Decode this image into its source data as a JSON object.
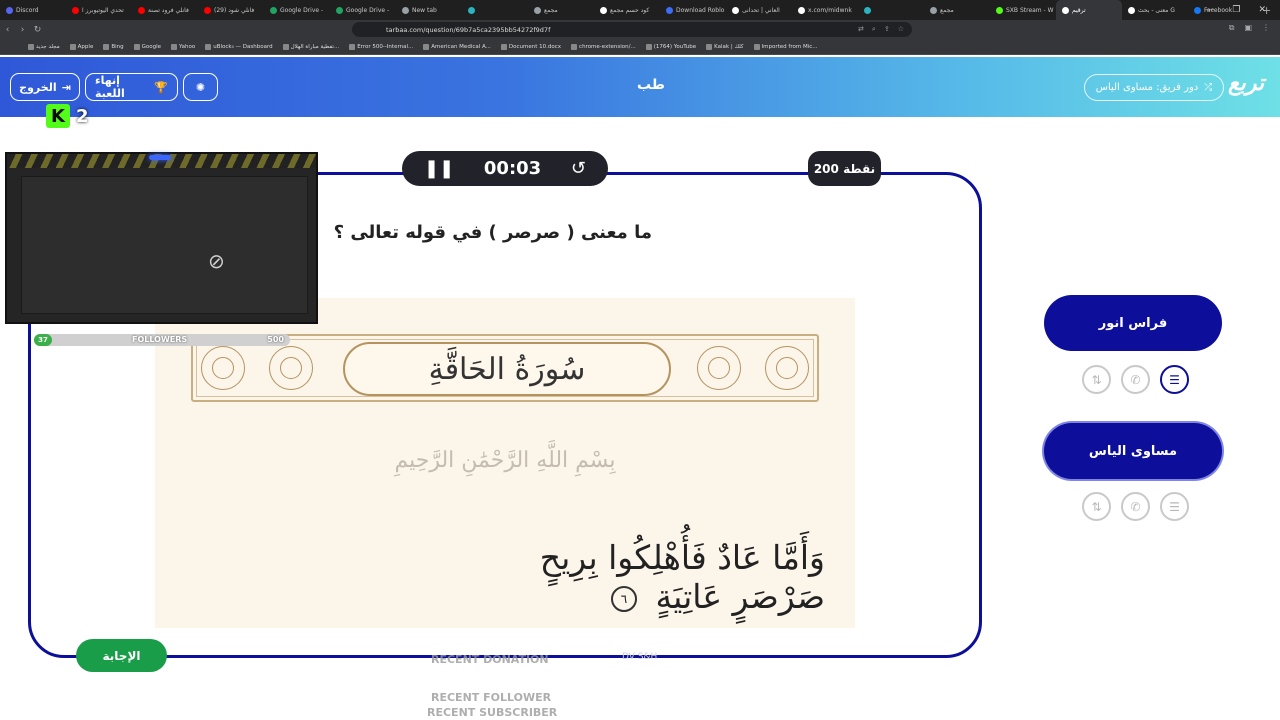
{
  "browser": {
    "tabs": [
      {
        "label": "Discord",
        "color": "#5865f2",
        "active": false
      },
      {
        "label": "تحدي اليوتيوبرز ا",
        "color": "#ff0000",
        "active": false
      },
      {
        "label": "فانلي فرود تصنة",
        "color": "#ff0000",
        "active": false
      },
      {
        "label": "(29) فانلي شود",
        "color": "#ff0000",
        "active": false
      },
      {
        "label": "Google Drive -",
        "color": "#1fa463",
        "active": false
      },
      {
        "label": "Google Drive -",
        "color": "#1fa463",
        "active": false
      },
      {
        "label": "New tab",
        "color": "#9aa0a6",
        "active": false
      },
      {
        "label": "",
        "color": "#2bb3c0",
        "active": false
      },
      {
        "label": "مجمع",
        "color": "#9aa0a6",
        "active": false
      },
      {
        "label": "كود حسم مجمع",
        "color": "#ffffff",
        "active": false
      },
      {
        "label": "Download Roblo",
        "color": "#3b6df5",
        "active": false
      },
      {
        "label": "العاني | تحدانى",
        "color": "#ffffff",
        "active": false
      },
      {
        "label": "x.com/midwnk",
        "color": "#ffffff",
        "active": false
      },
      {
        "label": "",
        "color": "#2bb3c0",
        "active": false
      },
      {
        "label": "مجمع",
        "color": "#9aa0a6",
        "active": false
      },
      {
        "label": "SXB Stream - W",
        "color": "#53fc18",
        "active": false
      },
      {
        "label": "ترقيم",
        "color": "#ffffff",
        "active": true
      },
      {
        "label": "معنى - بحث G",
        "color": "#ffffff",
        "active": false
      },
      {
        "label": "Facebook",
        "color": "#1877f2",
        "active": false
      }
    ],
    "url": "tarbaa.com/question/69b7a5ca2395bb54272f9d7f",
    "bookmarks": [
      "مجلد جديد",
      "Apple",
      "Bing",
      "Google",
      "Yahoo",
      "uBlock₀ — Dashboard",
      "تفطية مباراة الهلال...",
      "Error 500--Internal...",
      "American Medical A...",
      "Document 10.docx",
      "chrome-extension/...",
      "(1764) YouTube",
      "Kalak | كلك",
      "Imported from Mic..."
    ]
  },
  "header": {
    "exit_label": "الخروج",
    "end_game_label": "إنهاء اللعبة",
    "category_title": "طب",
    "turn_label": "دور فريق: مساوى الياس",
    "logo_text": "تربع"
  },
  "question": {
    "timer": "00:03",
    "points": "200 نقطة",
    "text": "ما معنى ( صرصر ) في قوله تعالى ؟",
    "image": {
      "surah_title": "سُورَةُ الحَاقَّةِ",
      "basmala": "بِسْمِ اللَّهِ الرَّحْمَٰنِ الرَّحِيمِ",
      "verse": "وَأَمَّا عَادٌ فَأُهْلِكُوا بِرِيحٍ صَرْصَرٍ عَاتِيَةٍ",
      "ayah_number": "٦"
    },
    "answer_label": "الإجابة"
  },
  "teams": [
    {
      "name": "فراس انور",
      "active_aid": "list"
    },
    {
      "name": "مساوى الياس",
      "active_aid": "none"
    }
  ],
  "aids": {
    "icons": [
      "swap-icon",
      "phone-icon",
      "list-icon"
    ]
  },
  "overlay": {
    "kick_count": "2",
    "followers_label": "FOLLOWERS",
    "followers_current": "37",
    "followers_goal": "500",
    "recent_donation": "RECENT DONATION",
    "recent_follower": "RECENT FOLLOWER",
    "recent_subscriber": "RECENT SUBSCRIBER",
    "faint_text": "DV S&H"
  },
  "colors": {
    "primary_navy": "#0d0e99",
    "answer_green": "#1a9d49",
    "timer_bg": "#22222a",
    "header_gradient_start": "#2f58d8",
    "header_gradient_end": "#6ee0e6"
  }
}
